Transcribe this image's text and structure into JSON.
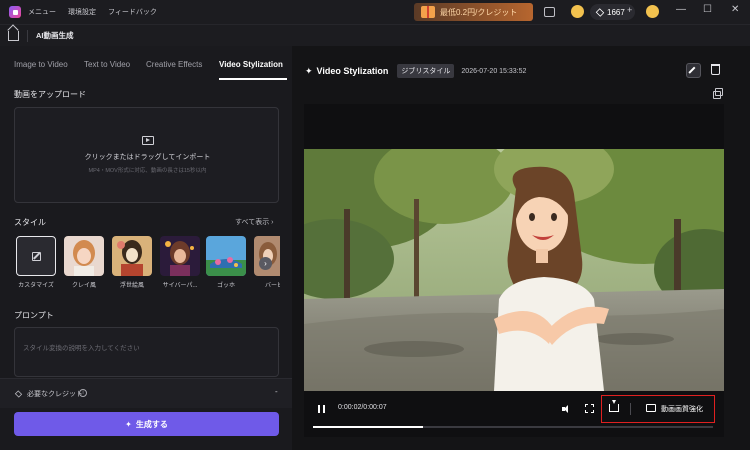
{
  "titlebar": {
    "menu": [
      "メニュー",
      "環境設定",
      "フィードバック"
    ],
    "promo": "最低0.2円/クレジット",
    "credits": "1667",
    "plus": "+",
    "minimize": "—",
    "maximize": "☐",
    "close": "✕"
  },
  "subheader": {
    "title": "AI動画生成"
  },
  "left": {
    "tabs": [
      "Image to Video",
      "Text to Video",
      "Creative Effects",
      "Video Stylization"
    ],
    "active_tab": "Video Stylization",
    "upload_title": "動画をアップロード",
    "upload_text": "クリックまたはドラッグしてインポート",
    "upload_hint": "MP4・MOV形式に対応、動画の長さは15秒以内",
    "style_title": "スタイル",
    "show_all": "すべて表示 ›",
    "styles": [
      "カスタマイズ",
      "クレイ風",
      "浮世絵風",
      "サイバーパ...",
      "ゴッホ",
      "バービ"
    ],
    "next": "›",
    "prompt_title": "プロンプト",
    "prompt_placeholder": "スタイル変換の説明を入力してください",
    "credit_label": "必要なクレジット",
    "info": "i",
    "credit_value": "-",
    "generate": "生成する"
  },
  "right": {
    "title": "Video Stylization",
    "style_tag": "ジブリスタイル",
    "timestamp": "2026-07-20 15:33:52",
    "time": "0:00:02/0:00:07",
    "progress": 0.275,
    "enhance": "動画画質強化"
  },
  "colors": {
    "accent": "#6f5ae8",
    "highlight": "#e02020"
  }
}
